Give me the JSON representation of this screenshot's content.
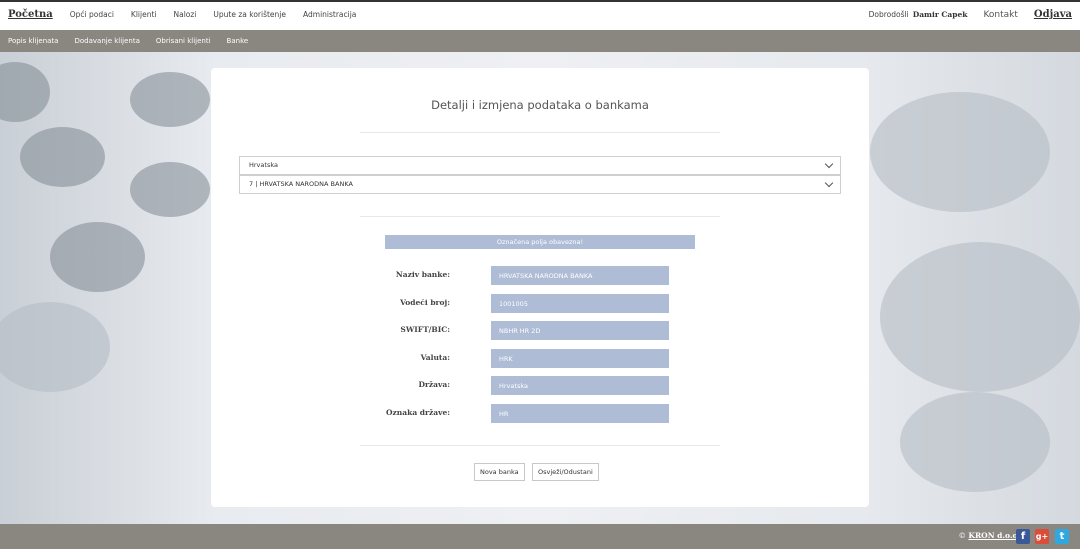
{
  "topbar": {
    "brand": "Početna",
    "nav": [
      "Opći podaci",
      "Klijenti",
      "Nalozi",
      "Upute za korištenje",
      "Administracija"
    ],
    "welcome": "Dobrodošli",
    "user": "Damir Capek",
    "contact": "Kontakt",
    "logout": "Odjava"
  },
  "subnav": [
    "Popis klijenata",
    "Dodavanje klijenta",
    "Obrisani klijenti",
    "Banke"
  ],
  "form": {
    "title": "Detalji i izmjena podataka o bankama",
    "country_select": "Hrvatska",
    "bank_select": "7 | HRVATSKA NARODNA BANKA",
    "required_note": "Označena polja obavezna!",
    "fields": [
      {
        "label": "Naziv banke:",
        "value": "HRVATSKA NARODNA BANKA"
      },
      {
        "label": "Vodeći broj:",
        "value": "1001005"
      },
      {
        "label": "SWIFT/BIC:",
        "value": "NBHR HR 2D"
      },
      {
        "label": "Valuta:",
        "value": "HRK"
      },
      {
        "label": "Država:",
        "value": "Hrvatska"
      },
      {
        "label": "Oznaka države:",
        "value": "HR"
      }
    ],
    "buttons": {
      "new": "Nova banka",
      "refresh": "Osvježi/Odustani"
    }
  },
  "footer": {
    "copyright_symbol": "©",
    "company": "KRON d.o.o."
  },
  "social": [
    {
      "name": "facebook-icon",
      "glyph": "f",
      "color": "#3b5998"
    },
    {
      "name": "google-plus-icon",
      "glyph": "g+",
      "color": "#dd4b39"
    },
    {
      "name": "twitter-icon",
      "glyph": "t",
      "color": "#2fa7e0"
    }
  ],
  "colors": {
    "field_bg": "#aebcd6",
    "bar": "#8a8680"
  }
}
